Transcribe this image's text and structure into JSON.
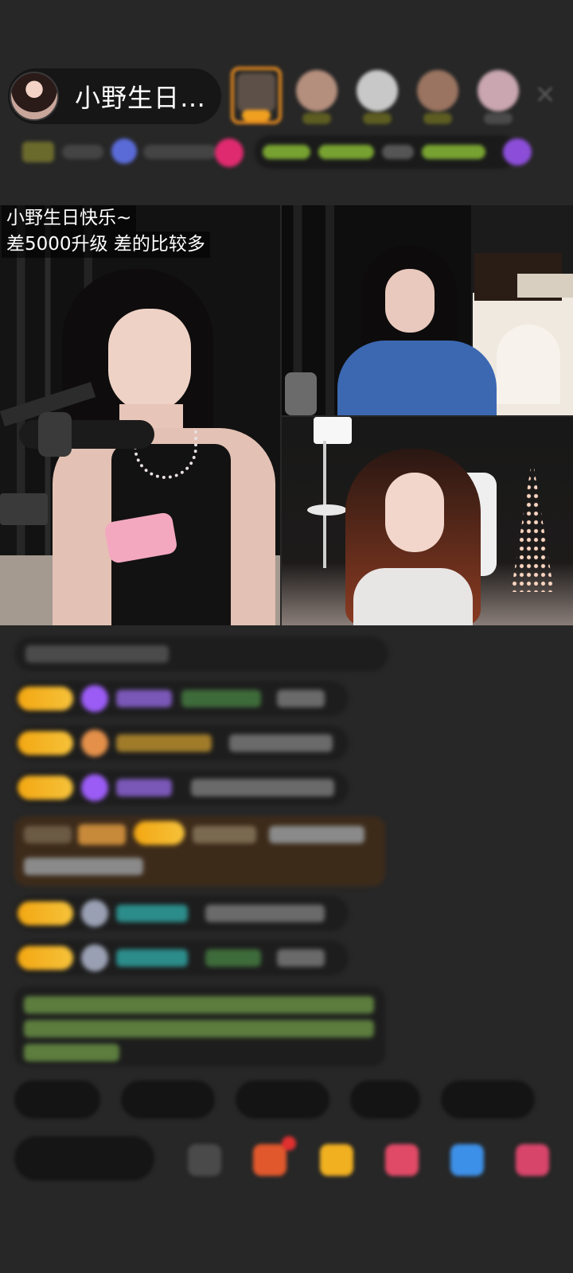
{
  "host": {
    "name": "小野生日…"
  },
  "viewers": [
    {
      "face": "#8a6b55",
      "tag": "#f0a020",
      "ring": "#e58a1f"
    },
    {
      "face": "#b58f7d",
      "tag": "#6c6c2a",
      "ring": "none"
    },
    {
      "face": "#c8c8c8",
      "tag": "#6c6c2a",
      "ring": "none"
    },
    {
      "face": "#9a7460",
      "tag": "#6c6c2a",
      "ring": "none"
    },
    {
      "face": "#c9a6b0",
      "tag": "#5a5a5a",
      "ring": "none"
    }
  ],
  "caption": {
    "line1": "小野生日快乐~",
    "line2": "差5000升级 差的比较多"
  },
  "colors": {
    "background": "#272727",
    "badge_gold": "#f3a712",
    "chat_purple": "#9b5cf6",
    "chat_teal": "#2bb7b0",
    "chat_green": "#9ad46c",
    "highlight_brown": "#3d2b1a"
  },
  "icons": {
    "close": "close-icon",
    "gift": "gift-icon",
    "more": "more-icon"
  }
}
